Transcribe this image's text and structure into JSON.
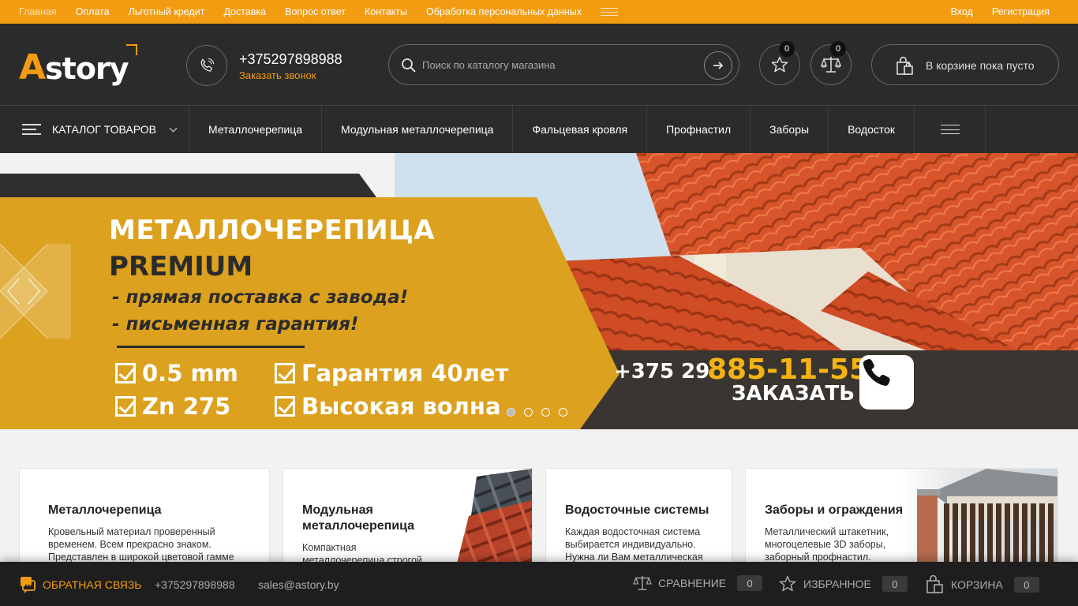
{
  "topbar": {
    "links": [
      "Главная",
      "Оплата",
      "Льготный кредит",
      "Доставка",
      "Вопрос ответ",
      "Контакты",
      "Обработка персональных данных"
    ],
    "login": "Вход",
    "register": "Регистрация"
  },
  "header": {
    "logo_first": "A",
    "logo_rest": "story",
    "phone": "+375297898988",
    "callback": "Заказать звонок",
    "search_placeholder": "Поиск по каталогу магазина",
    "favorites_count": "0",
    "compare_count": "0",
    "cart_text": "В корзине пока пусто"
  },
  "nav": {
    "catalog": "КАТАЛОГ ТОВАРОВ",
    "items": [
      "Металлочерепица",
      "Модульная металлочерепица",
      "Фальцевая кровля",
      "Профнастил",
      "Заборы",
      "Водосток"
    ]
  },
  "banner": {
    "title1": "МЕТАЛЛОЧЕРЕПИЦА",
    "title2": "PREMIUM",
    "line1": "- прямая поставка с завода!",
    "line2": "- письменная гарантия!",
    "features": [
      "0.5 mm",
      "Гарантия 40лет",
      "Zn 275",
      "Высокая волна"
    ],
    "phone_prefix": "+375 29",
    "phone_main": "885-11-55",
    "order": "ЗАКАЗАТЬ",
    "slides": 4,
    "active_slide": 1
  },
  "cards": [
    {
      "title": "Металлочерепица",
      "text": "Кровельный материал проверенный временем. Всем прекрасно знаком. Представлен в широкой цветовой гамме"
    },
    {
      "title": "Модульная металлочерепица",
      "text": "Компактная металлочерепица строгой"
    },
    {
      "title": "Водосточные системы",
      "text": "Каждая водосточная система выбирается индивидуально. Нужна ли Вам металлическая"
    },
    {
      "title": "Заборы и ограждения",
      "text": "Металлический штакетник, многоцелевые 3D заборы, заборный профнастил."
    }
  ],
  "footer": {
    "feedback": "ОБРАТНАЯ СВЯЗЬ",
    "phone": "+375297898988",
    "email": "sales@astory.by",
    "compare": "СРАВНЕНИЕ",
    "compare_count": "0",
    "favorites": "ИЗБРАННОЕ",
    "favorites_count": "0",
    "cart": "КОРЗИНА",
    "cart_count": "0"
  },
  "colors": {
    "accent": "#f39c12",
    "dark": "#2b2b2b",
    "banner_yellow": "#dca11e"
  }
}
